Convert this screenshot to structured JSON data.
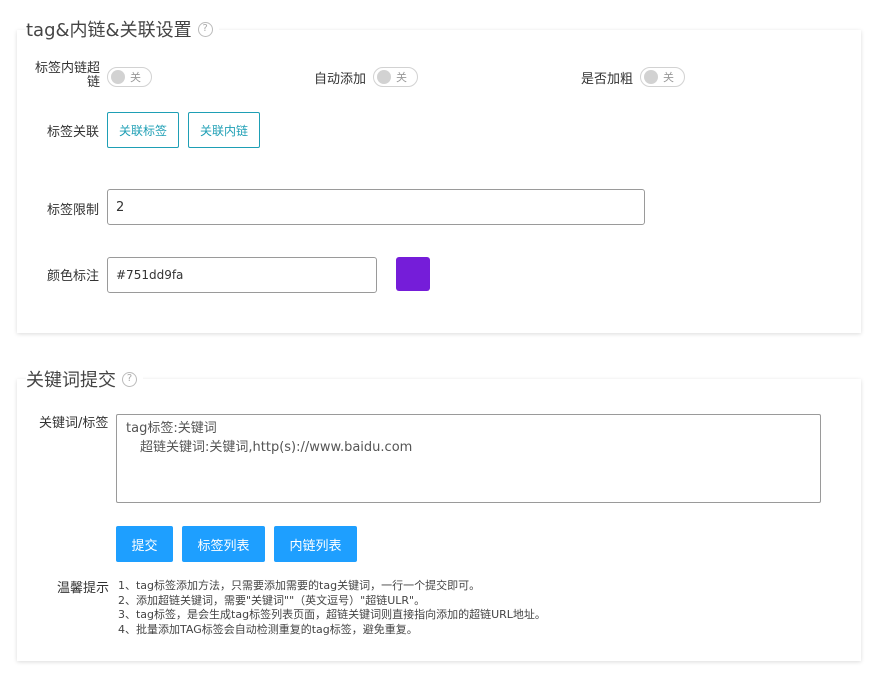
{
  "section1": {
    "title": "tag&内链&关联设置",
    "help": "?",
    "tag_link_label_1": "标签内链超",
    "tag_link_label_2": "链",
    "auto_add_label": "自动添加",
    "bold_label": "是否加粗",
    "switch_off_text": "关",
    "tag_relation_label": "标签关联",
    "relate_tag_button": "关联标签",
    "relate_link_button": "关联内链",
    "tag_limit_label": "标签限制",
    "tag_limit_value": "2",
    "color_label": "颜色标注",
    "color_value": "#751dd9fa",
    "swatch_color": "#751dd9"
  },
  "section2": {
    "title": "关键词提交",
    "help": "?",
    "keyword_label": "关键词/标签",
    "textarea_line1": "tag标签:关键词",
    "textarea_line2": "超链关键词:关键词,http(s)://www.baidu.com",
    "submit_button": "提交",
    "tag_list_button": "标签列表",
    "link_list_button": "内链列表",
    "tips_label": "温馨提示",
    "tips": [
      "1、tag标签添加方法，只需要添加需要的tag关键词，一行一个提交即可。",
      "2、添加超链关键词，需要\"关键词\"\"（英文逗号）\"超链ULR\"。",
      "3、tag标签，是会生成tag标签列表页面，超链关键词则直接指向添加的超链URL地址。",
      "4、批量添加TAG标签会自动检测重复的tag标签，避免重复。"
    ]
  }
}
